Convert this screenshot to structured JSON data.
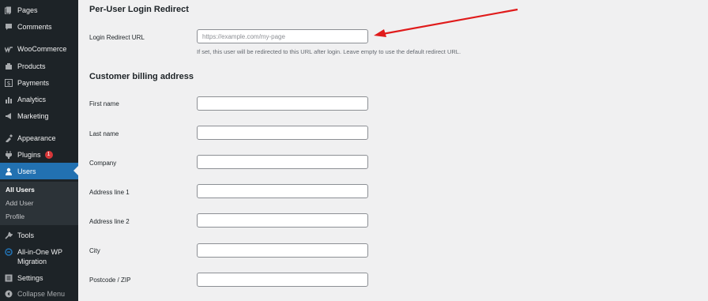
{
  "sidebar": {
    "items": [
      {
        "id": "pages",
        "label": "Pages",
        "icon": "pages-icon"
      },
      {
        "id": "comments",
        "label": "Comments",
        "icon": "comments-icon"
      },
      {
        "id": "woocommerce",
        "label": "WooCommerce",
        "icon": "woocommerce-icon"
      },
      {
        "id": "products",
        "label": "Products",
        "icon": "products-icon"
      },
      {
        "id": "payments",
        "label": "Payments",
        "icon": "payments-icon"
      },
      {
        "id": "analytics",
        "label": "Analytics",
        "icon": "analytics-icon"
      },
      {
        "id": "marketing",
        "label": "Marketing",
        "icon": "marketing-icon"
      },
      {
        "id": "appearance",
        "label": "Appearance",
        "icon": "appearance-icon"
      },
      {
        "id": "plugins",
        "label": "Plugins",
        "icon": "plugins-icon",
        "badge": "1"
      },
      {
        "id": "users",
        "label": "Users",
        "icon": "users-icon",
        "active": true
      },
      {
        "id": "tools",
        "label": "Tools",
        "icon": "tools-icon"
      },
      {
        "id": "all-in-one",
        "label_line1": "All-in-One WP",
        "label_line2": "Migration",
        "icon": "migration-icon"
      },
      {
        "id": "settings",
        "label": "Settings",
        "icon": "settings-icon"
      }
    ],
    "submenu": [
      {
        "label": "All Users",
        "current": true
      },
      {
        "label": "Add User"
      },
      {
        "label": "Profile"
      }
    ],
    "collapse_label": "Collapse Menu"
  },
  "redirect_section": {
    "title": "Per-User Login Redirect",
    "field_label": "Login Redirect URL",
    "placeholder": "https://example.com/my-page",
    "value": "",
    "help": "If set, this user will be redirected to this URL after login. Leave empty to use the default redirect URL."
  },
  "billing_section": {
    "title": "Customer billing address",
    "fields": [
      {
        "label": "First name",
        "value": ""
      },
      {
        "label": "Last name",
        "value": ""
      },
      {
        "label": "Company",
        "value": ""
      },
      {
        "label": "Address line 1",
        "value": ""
      },
      {
        "label": "Address line 2",
        "value": ""
      },
      {
        "label": "City",
        "value": ""
      },
      {
        "label": "Postcode / ZIP",
        "value": ""
      }
    ]
  },
  "colors": {
    "sidebar_bg": "#1d2327",
    "active_bg": "#2271b1",
    "badge": "#d63638",
    "arrow": "#e01b1b",
    "page_bg": "#f0f0f1"
  }
}
